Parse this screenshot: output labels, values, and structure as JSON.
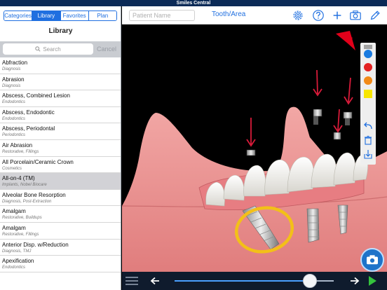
{
  "status_bar": {
    "title": "Smiles Central"
  },
  "sidebar": {
    "tabs": [
      {
        "label": "Categories",
        "active": false
      },
      {
        "label": "Library",
        "active": true
      },
      {
        "label": "Favorites",
        "active": false
      },
      {
        "label": "Plan",
        "active": false
      }
    ],
    "title": "Library",
    "search": {
      "placeholder": "Search",
      "cancel_label": "Cancel"
    },
    "items": [
      {
        "name": "Abfraction",
        "sub": "Diagnosis",
        "selected": false
      },
      {
        "name": "Abrasion",
        "sub": "Diagnosis",
        "selected": false
      },
      {
        "name": "Abscess, Combined Lesion",
        "sub": "Endodontics",
        "selected": false
      },
      {
        "name": "Abscess, Endodontic",
        "sub": "Endodontics",
        "selected": false
      },
      {
        "name": "Abscess, Periodontal",
        "sub": "Periodontics",
        "selected": false
      },
      {
        "name": "Air Abrasion",
        "sub": "Restorative, Fillings",
        "selected": false
      },
      {
        "name": "All Porcelain/Ceramic Crown",
        "sub": "Cosmetics",
        "selected": false
      },
      {
        "name": "All-on-4 (TM)",
        "sub": "Implants, Nobel Biocare",
        "selected": true
      },
      {
        "name": "Alveolar Bone Resorption",
        "sub": "Diagnosis, Post-Extraction",
        "selected": false
      },
      {
        "name": "Amalgam",
        "sub": "Restorative, Buildups",
        "selected": false
      },
      {
        "name": "Amalgam",
        "sub": "Restorative, Fillings",
        "selected": false
      },
      {
        "name": "Anterior Disp. w/Reduction",
        "sub": "Diagnosis, TMJ",
        "selected": false
      },
      {
        "name": "Apexification",
        "sub": "Endodontics",
        "selected": false
      }
    ]
  },
  "topbar": {
    "patient_placeholder": "Patient Name",
    "tooth_area_label": "Tooth/Area",
    "icons": [
      "gear-icon",
      "help-icon",
      "add-icon",
      "camera-icon",
      "pencil-icon"
    ]
  },
  "viewer": {
    "palette": {
      "colors": [
        "#1a7be0",
        "#e42222",
        "#f28a18",
        "#f7e600"
      ],
      "tools": [
        "undo-icon",
        "trash-icon",
        "download-icon"
      ]
    },
    "highlight_color": "#f3c018",
    "arrow_color": "#d81b3a",
    "fab_icon": "camera-icon"
  },
  "playback": {
    "progress": 0.85,
    "controls": [
      "menu-icon",
      "step-back-icon",
      "step-forward-icon",
      "play-icon"
    ]
  }
}
